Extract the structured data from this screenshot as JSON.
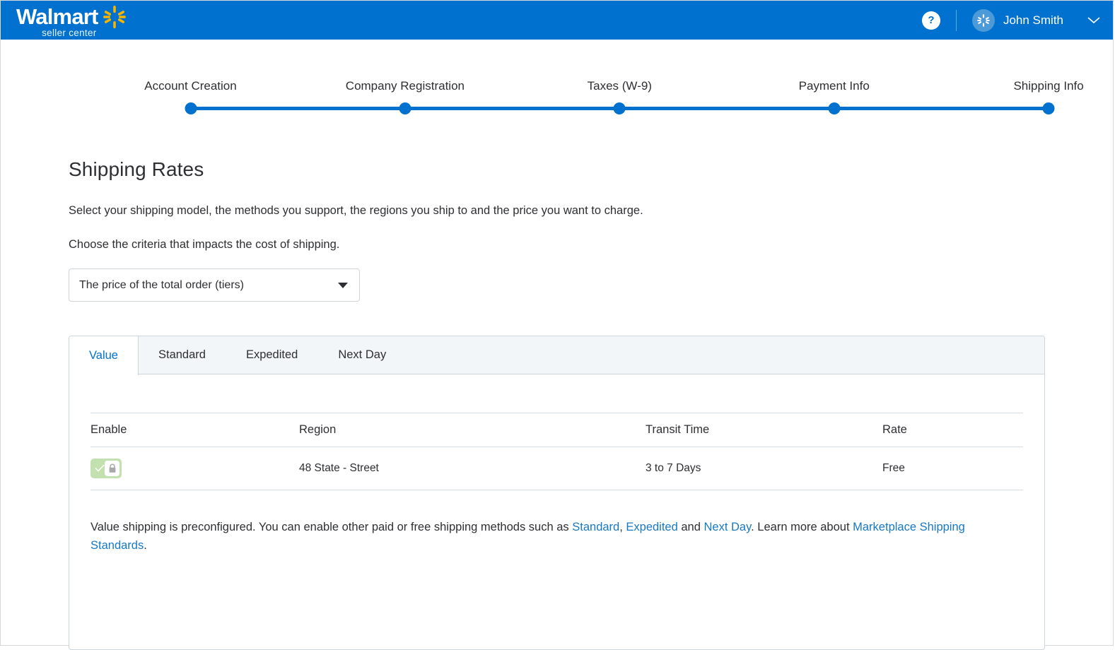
{
  "header": {
    "brand_name": "Walmart",
    "brand_sub": "seller center",
    "help_label": "?",
    "user_name": "John Smith",
    "caret": "chevron-down",
    "bar_color": "#0071ce",
    "avatar_color": "#4d9ad8"
  },
  "stepper": {
    "accent": "#0071ce",
    "steps": [
      {
        "label": "Account Creation",
        "pos": 15.0,
        "complete": true
      },
      {
        "label": "Company Registration",
        "pos": 35.5,
        "complete": true
      },
      {
        "label": "Taxes (W-9)",
        "pos": 56.0,
        "complete": true
      },
      {
        "label": "Payment Info",
        "pos": 76.5,
        "complete": true
      },
      {
        "label": "Shipping Info",
        "pos": 97.0,
        "complete": true
      }
    ]
  },
  "main": {
    "title": "Shipping Rates",
    "description": "Select your shipping model, the methods you support, the regions you ship to and the price you want to charge.",
    "description2": "Choose the criteria that impacts the cost of shipping.",
    "criteria_select": {
      "value": "The price of the total order (tiers)",
      "options": [
        "The price of the total order (tiers)"
      ]
    },
    "tabs": [
      {
        "label": "Value",
        "active": true
      },
      {
        "label": "Standard",
        "active": false
      },
      {
        "label": "Expedited",
        "active": false
      },
      {
        "label": "Next Day",
        "active": false
      }
    ],
    "table": {
      "columns": [
        "Enable",
        "Region",
        "Transit Time",
        "Rate"
      ],
      "rows": [
        {
          "enabled": true,
          "locked": true,
          "region": "48 State - Street",
          "transit_time": "3 to 7 Days",
          "rate": "Free"
        }
      ]
    },
    "note": {
      "part1": "Value shipping is preconfigured. You can enable other paid or free shipping methods such as ",
      "link1": "Standard",
      "part2": ", ",
      "link2": "Expedited",
      "part3": " and ",
      "link3": "Next Day",
      "part4": ". Learn more about ",
      "link4": "Marketplace Shipping Standards",
      "part5": "."
    }
  }
}
